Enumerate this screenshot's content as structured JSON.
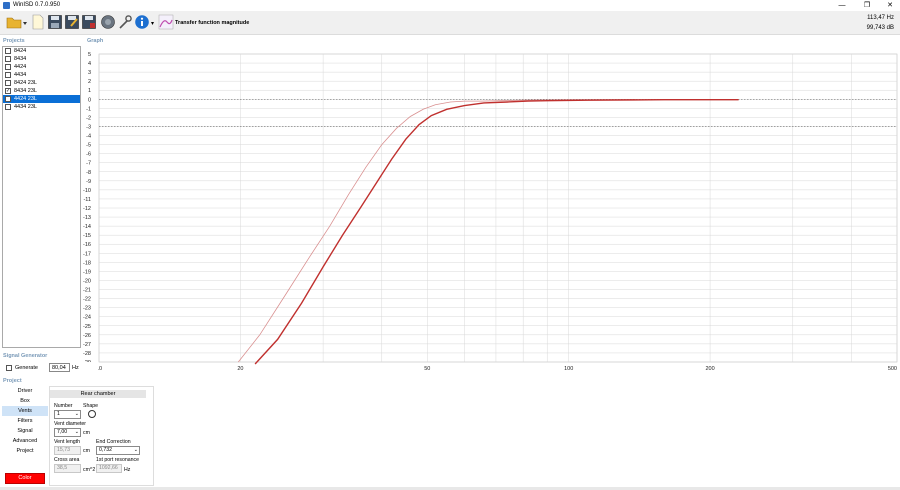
{
  "window": {
    "title": "WinISD 0.7.0.950",
    "minimize_glyph": "—",
    "restore_glyph": "❐",
    "close_glyph": "✕"
  },
  "toolbar": {
    "buttons": [
      "open-folder-icon",
      "new-file-icon",
      "save-icon",
      "save-as-icon",
      "save-all-icon",
      "driver-icon",
      "tools-icon",
      "info-icon",
      "graph-icon"
    ],
    "graph_label": "Transfer function magnitude",
    "readout_freq": "113,47 Hz",
    "readout_db": "99,743 dB"
  },
  "projects": {
    "label": "Projects",
    "items": [
      {
        "label": "8424",
        "checked": false,
        "selected": false
      },
      {
        "label": "8434",
        "checked": false,
        "selected": false
      },
      {
        "label": "4424",
        "checked": false,
        "selected": false
      },
      {
        "label": "4434",
        "checked": false,
        "selected": false
      },
      {
        "label": "8424 23L",
        "checked": false,
        "selected": false
      },
      {
        "label": "8434 23L",
        "checked": true,
        "selected": false
      },
      {
        "label": "4424 23L",
        "checked": true,
        "selected": true
      },
      {
        "label": "4434 23L",
        "checked": false,
        "selected": false
      }
    ]
  },
  "graph": {
    "label": "Graph"
  },
  "chart_data": {
    "type": "line",
    "x_scale": "log",
    "xlim": [
      10,
      500
    ],
    "ylim": [
      -29,
      5
    ],
    "x_ticks": [
      10,
      20,
      50,
      100,
      200,
      500
    ],
    "y_ticks": [
      5,
      4,
      3,
      2,
      1,
      0,
      -1,
      -2,
      -3,
      -4,
      -5,
      -6,
      -7,
      -8,
      -9,
      -10,
      -11,
      -12,
      -13,
      -14,
      -15,
      -16,
      -17,
      -18,
      -19,
      -20,
      -21,
      -22,
      -23,
      -24,
      -25,
      -26,
      -27,
      -28,
      -29
    ],
    "reference_lines": [
      0,
      -3
    ],
    "grid": true,
    "series": [
      {
        "color": "#d99090",
        "x": [
          19.8,
          22,
          25,
          28,
          31,
          34,
          37,
          40,
          43,
          46,
          49,
          52,
          56,
          60,
          65,
          72,
          80,
          100,
          150,
          230
        ],
        "y": [
          -29,
          -26,
          -21.5,
          -17.5,
          -14,
          -10.5,
          -7.5,
          -5,
          -3.2,
          -1.9,
          -1.1,
          -0.6,
          -0.3,
          -0.2,
          -0.2,
          -0.15,
          -0.1,
          -0.05,
          -0.05,
          -0.05
        ]
      },
      {
        "color": "#c0302e",
        "x": [
          21.5,
          24,
          27,
          30,
          33,
          36,
          39,
          42,
          45,
          48,
          51,
          55,
          60,
          66,
          74,
          82,
          90,
          110,
          160,
          230
        ],
        "y": [
          -29.5,
          -26.5,
          -22.5,
          -18.5,
          -15,
          -12,
          -9.2,
          -6.6,
          -4.4,
          -2.8,
          -1.8,
          -1.1,
          -0.7,
          -0.4,
          -0.3,
          -0.2,
          -0.15,
          -0.1,
          -0.05,
          -0.05
        ]
      }
    ]
  },
  "signal_generator": {
    "label": "Signal Generator",
    "generate_label": "Generate",
    "frequency": "80,04",
    "unit": "Hz"
  },
  "project": {
    "label": "Project",
    "nav": [
      "Driver",
      "Box",
      "Vents",
      "Filters",
      "Signal",
      "Advanced",
      "Project"
    ],
    "active_nav": "Vents",
    "color_button": "Color"
  },
  "vents": {
    "header": "Rear chamber",
    "number_label": "Number",
    "number_value": "1",
    "shape_label": "Shape",
    "diameter_label": "Vent diameter",
    "diameter_value": "7,00",
    "diameter_unit": "cm",
    "length_label": "Vent length",
    "length_value": "15,73",
    "length_unit": "cm",
    "end_correction_label": "End Correction",
    "end_correction_value": "0,732",
    "cross_area_label": "Cross area",
    "cross_area_value": "38,5",
    "cross_area_unit": "cm^2",
    "port_resonance_label": "1st port resonance",
    "port_resonance_value": "1092,66",
    "port_resonance_unit": "Hz"
  }
}
